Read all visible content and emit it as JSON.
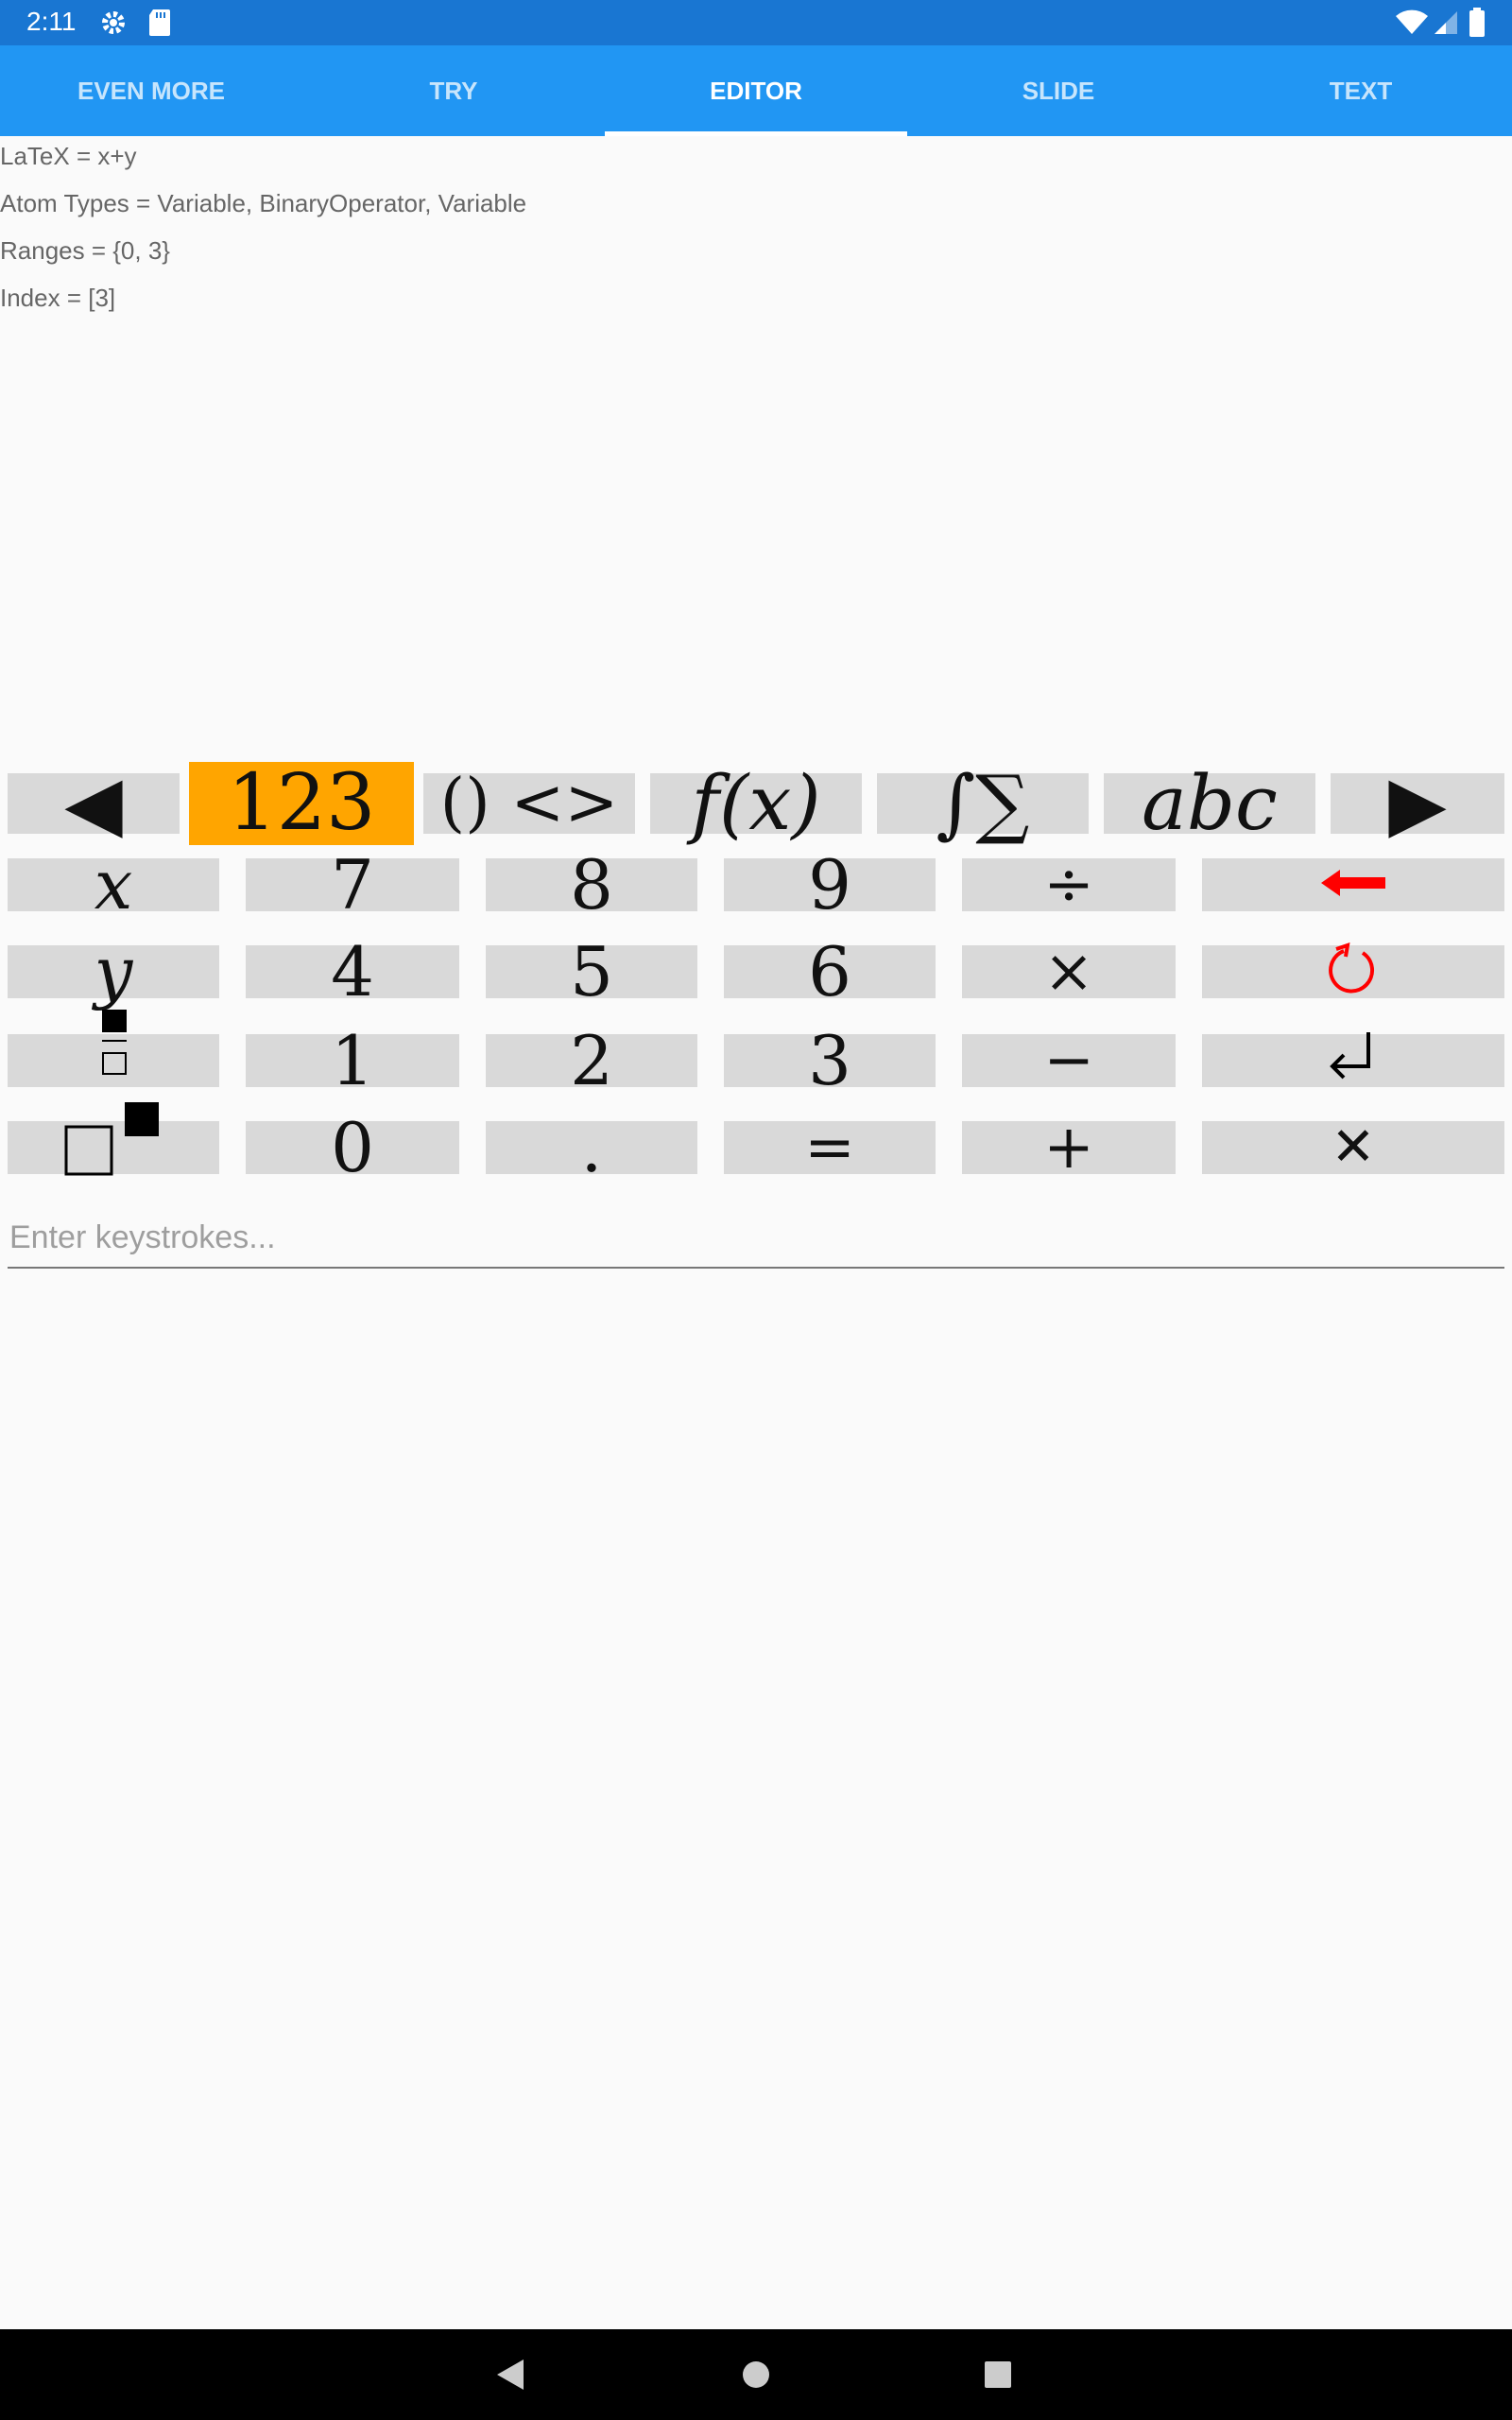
{
  "status_bar": {
    "time": "2:11",
    "icons": [
      "gear-icon",
      "sd-card-icon",
      "wifi-icon",
      "signal-icon",
      "battery-icon"
    ]
  },
  "tabs": [
    {
      "label": "EVEN MORE",
      "active": false
    },
    {
      "label": "TRY",
      "active": false
    },
    {
      "label": "EDITOR",
      "active": true
    },
    {
      "label": "SLIDE",
      "active": false
    },
    {
      "label": "TEXT",
      "active": false
    }
  ],
  "info": {
    "latex": "LaTeX = x+y",
    "atom_types": "Atom Types = Variable, BinaryOperator, Variable",
    "ranges": "Ranges = {0, 3}",
    "index": "Index = [3]"
  },
  "keyboard": {
    "top_row": [
      "◀",
      "123",
      "() <>",
      "f(x)",
      "∫∑",
      "abc",
      "▶"
    ],
    "rows": [
      [
        "x",
        "7",
        "8",
        "9",
        "÷",
        "⬅"
      ],
      [
        "y",
        "4",
        "5",
        "6",
        "×",
        "↻"
      ],
      [
        "fraction",
        "1",
        "2",
        "3",
        "−",
        "↲"
      ],
      [
        "power",
        "0",
        ".",
        "=",
        "+",
        "✕"
      ]
    ],
    "selected_tab": "123",
    "accent_color": "#ffa500",
    "key_color": "#d9d9d9",
    "backspace_color": "#ff0000"
  },
  "input": {
    "placeholder": "Enter keystrokes...",
    "value": ""
  },
  "colors": {
    "status_bar": "#1976d2",
    "tab_bar": "#2196f3",
    "nav_bar": "#000000"
  }
}
